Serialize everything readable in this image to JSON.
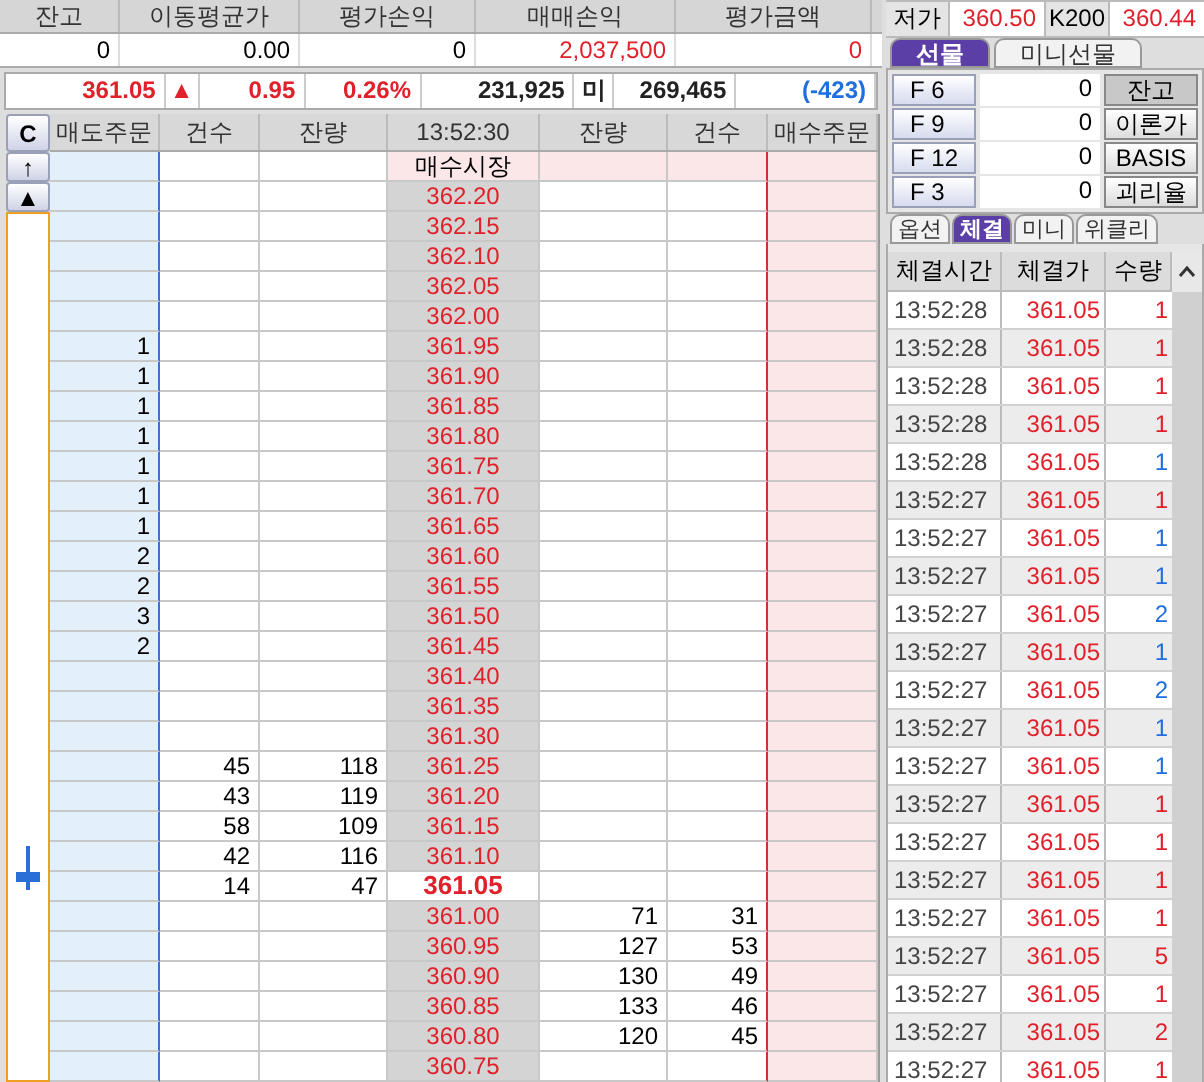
{
  "position": {
    "columns": [
      "잔고",
      "이동평균가",
      "평가손익",
      "매매손익",
      "평가금액"
    ],
    "values": [
      {
        "text": "0",
        "color": "#000000"
      },
      {
        "text": "0.00",
        "color": "#000000"
      },
      {
        "text": "0",
        "color": "#000000"
      },
      {
        "text": "2,037,500",
        "color": "#e0202a"
      },
      {
        "text": "0",
        "color": "#e0202a"
      }
    ]
  },
  "quote": [
    {
      "text": "361.05",
      "color": "#e0202a"
    },
    {
      "text": "▲",
      "color": "#e0202a"
    },
    {
      "text": "0.95",
      "color": "#e0202a"
    },
    {
      "text": "0.26%",
      "color": "#e0202a"
    },
    {
      "text": "231,925",
      "color": "#222222"
    },
    {
      "text": "미",
      "color": "#222222"
    },
    {
      "text": "269,465",
      "color": "#222222"
    },
    {
      "text": "(-423)",
      "color": "#1f6fe0"
    }
  ],
  "orderbook": {
    "buttons": [
      "C",
      "↑",
      "▲"
    ],
    "columns": [
      "매도주문",
      "건수",
      "잔량",
      "13:52:30",
      "잔량",
      "건수",
      "매수주문"
    ],
    "rows": [
      {
        "kind": "market",
        "price": "매수시장"
      },
      {
        "kind": "price",
        "price": "362.20",
        "current": false
      },
      {
        "kind": "price",
        "price": "362.15",
        "current": false
      },
      {
        "kind": "price",
        "price": "362.10",
        "current": false
      },
      {
        "kind": "price",
        "price": "362.05",
        "current": false
      },
      {
        "kind": "price",
        "price": "362.00",
        "current": false
      },
      {
        "kind": "price",
        "price": "361.95",
        "sell_orders": "1",
        "current": false
      },
      {
        "kind": "price",
        "price": "361.90",
        "sell_orders": "1",
        "current": false
      },
      {
        "kind": "price",
        "price": "361.85",
        "sell_orders": "1",
        "current": false
      },
      {
        "kind": "price",
        "price": "361.80",
        "sell_orders": "1",
        "current": false
      },
      {
        "kind": "price",
        "price": "361.75",
        "sell_orders": "1",
        "current": false
      },
      {
        "kind": "price",
        "price": "361.70",
        "sell_orders": "1",
        "current": false
      },
      {
        "kind": "price",
        "price": "361.65",
        "sell_orders": "1",
        "current": false
      },
      {
        "kind": "price",
        "price": "361.60",
        "sell_orders": "2",
        "current": false
      },
      {
        "kind": "price",
        "price": "361.55",
        "sell_orders": "2",
        "current": false
      },
      {
        "kind": "price",
        "price": "361.50",
        "sell_orders": "3",
        "current": false
      },
      {
        "kind": "price",
        "price": "361.45",
        "sell_orders": "2",
        "current": false
      },
      {
        "kind": "price",
        "price": "361.40",
        "current": false
      },
      {
        "kind": "price",
        "price": "361.35",
        "current": false
      },
      {
        "kind": "price",
        "price": "361.30",
        "current": false
      },
      {
        "kind": "price",
        "price": "361.25",
        "sell_count": "45",
        "sell_qty": "118",
        "current": false
      },
      {
        "kind": "price",
        "price": "361.20",
        "sell_count": "43",
        "sell_qty": "119",
        "current": false
      },
      {
        "kind": "price",
        "price": "361.15",
        "sell_count": "58",
        "sell_qty": "109",
        "current": false
      },
      {
        "kind": "price",
        "price": "361.10",
        "sell_count": "42",
        "sell_qty": "116",
        "current": false
      },
      {
        "kind": "price",
        "price": "361.05",
        "sell_count": "14",
        "sell_qty": "47",
        "current": true
      },
      {
        "kind": "price",
        "price": "361.00",
        "buy_qty": "71",
        "buy_count": "31",
        "current": false
      },
      {
        "kind": "price",
        "price": "360.95",
        "buy_qty": "127",
        "buy_count": "53",
        "current": false
      },
      {
        "kind": "price",
        "price": "360.90",
        "buy_qty": "130",
        "buy_count": "49",
        "current": false
      },
      {
        "kind": "price",
        "price": "360.85",
        "buy_qty": "133",
        "buy_count": "46",
        "current": false
      },
      {
        "kind": "price",
        "price": "360.80",
        "buy_qty": "120",
        "buy_count": "45",
        "current": false
      },
      {
        "kind": "price",
        "price": "360.75",
        "current": false
      }
    ]
  },
  "low_row": {
    "label": "저가",
    "value": "360.50",
    "index_label": "K200",
    "index_value": "360.44"
  },
  "product_tabs": [
    {
      "label": "선물",
      "selected": true
    },
    {
      "label": "미니선물",
      "selected": false
    }
  ],
  "contracts": [
    {
      "key": "F 6",
      "value": "0",
      "action": "잔고",
      "selected": true
    },
    {
      "key": "F 9",
      "value": "0",
      "action": "이론가",
      "selected": false
    },
    {
      "key": "F 12",
      "value": "0",
      "action": "BASIS",
      "selected": false
    },
    {
      "key": "F 3",
      "value": "0",
      "action": "괴리율",
      "selected": false
    }
  ],
  "trade_tabs": [
    {
      "label": "옵션",
      "selected": false
    },
    {
      "label": "체결",
      "selected": true
    },
    {
      "label": "미니",
      "selected": false
    },
    {
      "label": "위클리",
      "selected": false
    }
  ],
  "trades": {
    "columns": [
      "체결시간",
      "체결가",
      "수량"
    ],
    "rows": [
      {
        "time": "13:52:28",
        "price": "361.05",
        "qty": "1",
        "color": "#e0202a"
      },
      {
        "time": "13:52:28",
        "price": "361.05",
        "qty": "1",
        "color": "#e0202a"
      },
      {
        "time": "13:52:28",
        "price": "361.05",
        "qty": "1",
        "color": "#e0202a"
      },
      {
        "time": "13:52:28",
        "price": "361.05",
        "qty": "1",
        "color": "#e0202a"
      },
      {
        "time": "13:52:28",
        "price": "361.05",
        "qty": "1",
        "color": "#1f6fe0"
      },
      {
        "time": "13:52:27",
        "price": "361.05",
        "qty": "1",
        "color": "#e0202a"
      },
      {
        "time": "13:52:27",
        "price": "361.05",
        "qty": "1",
        "color": "#1f6fe0"
      },
      {
        "time": "13:52:27",
        "price": "361.05",
        "qty": "1",
        "color": "#1f6fe0"
      },
      {
        "time": "13:52:27",
        "price": "361.05",
        "qty": "2",
        "color": "#1f6fe0"
      },
      {
        "time": "13:52:27",
        "price": "361.05",
        "qty": "1",
        "color": "#1f6fe0"
      },
      {
        "time": "13:52:27",
        "price": "361.05",
        "qty": "2",
        "color": "#1f6fe0"
      },
      {
        "time": "13:52:27",
        "price": "361.05",
        "qty": "1",
        "color": "#1f6fe0"
      },
      {
        "time": "13:52:27",
        "price": "361.05",
        "qty": "1",
        "color": "#1f6fe0"
      },
      {
        "time": "13:52:27",
        "price": "361.05",
        "qty": "1",
        "color": "#e0202a"
      },
      {
        "time": "13:52:27",
        "price": "361.05",
        "qty": "1",
        "color": "#e0202a"
      },
      {
        "time": "13:52:27",
        "price": "361.05",
        "qty": "1",
        "color": "#e0202a"
      },
      {
        "time": "13:52:27",
        "price": "361.05",
        "qty": "1",
        "color": "#e0202a"
      },
      {
        "time": "13:52:27",
        "price": "361.05",
        "qty": "5",
        "color": "#e0202a"
      },
      {
        "time": "13:52:27",
        "price": "361.05",
        "qty": "1",
        "color": "#e0202a"
      },
      {
        "time": "13:52:27",
        "price": "361.05",
        "qty": "2",
        "color": "#e0202a"
      },
      {
        "time": "13:52:27",
        "price": "361.05",
        "qty": "1",
        "color": "#e0202a"
      }
    ]
  }
}
